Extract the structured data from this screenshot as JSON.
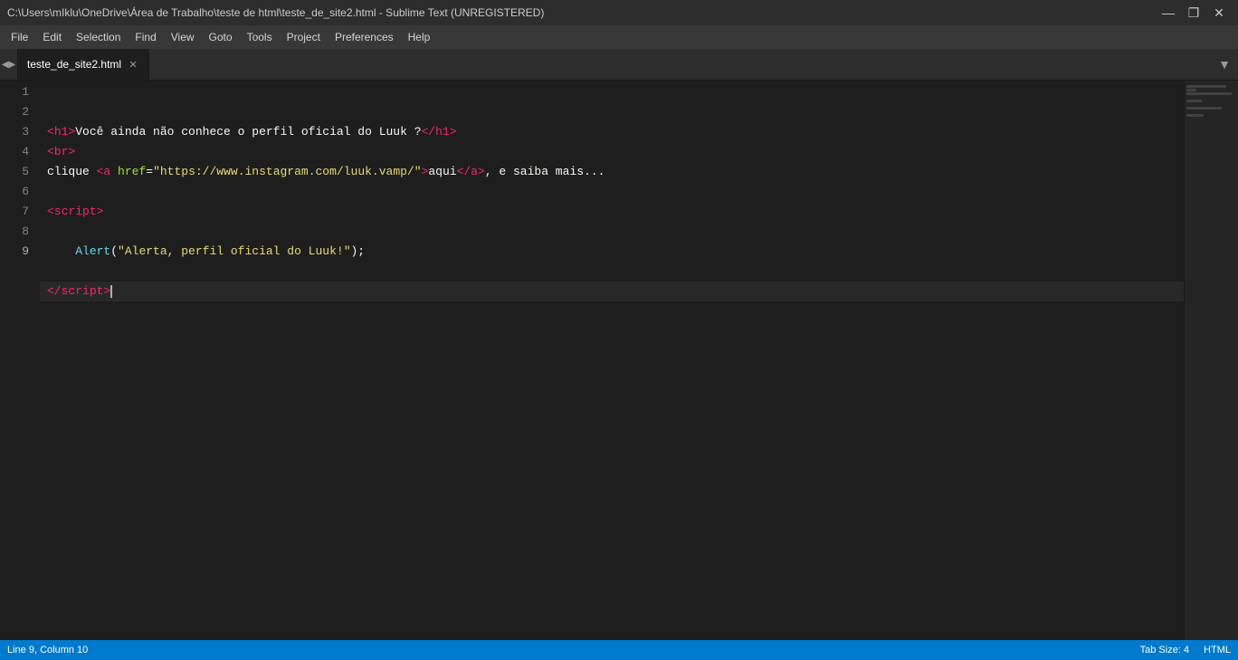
{
  "titlebar": {
    "path": "C:\\Users\\mIklu\\OneDrive\\Área de Trabalho\\teste de html\\teste_de_site2.html - Sublime Text (UNREGISTERED)",
    "minimize": "—",
    "maximize": "❐",
    "close": "✕"
  },
  "menubar": {
    "items": [
      "File",
      "Edit",
      "Selection",
      "Find",
      "View",
      "Goto",
      "Tools",
      "Project",
      "Preferences",
      "Help"
    ]
  },
  "tabs": {
    "active": "teste_de_site2.html",
    "items": [
      {
        "label": "teste_de_site2.html",
        "active": true
      }
    ]
  },
  "statusbar": {
    "left": {
      "position": "Line 9, Column 10"
    },
    "right": {
      "tab_size": "Tab Size: 4",
      "language": "HTML"
    }
  },
  "code": {
    "lines": [
      {
        "num": "1",
        "content_html": "<span class='tag'>&lt;</span><span class='tag-name'>h1</span><span class='tag'>&gt;</span><span class='plain'>Você ainda não conhece o perfil oficial do Luuk ?</span><span class='tag'>&lt;/</span><span class='tag-name'>h1</span><span class='tag'>&gt;</span>"
      },
      {
        "num": "2",
        "content_html": "<span class='tag'>&lt;</span><span class='tag-name'>br</span><span class='tag'>&gt;</span>"
      },
      {
        "num": "3",
        "content_html": "<span class='plain'>clique </span><span class='tag'>&lt;</span><span class='tag-name'>a</span><span class='plain'> </span><span class='attr-name'>href</span><span class='plain'>=</span><span class='attr-value'>\"https://www.instagram.com/luuk.vamp/\"</span><span class='tag'>&gt;</span><span class='plain'>aqui</span><span class='tag'>&lt;/</span><span class='tag-name'>a</span><span class='tag'>&gt;</span><span class='plain'>, e saiba mais...</span>"
      },
      {
        "num": "4",
        "content_html": ""
      },
      {
        "num": "5",
        "content_html": "<span class='tag'>&lt;</span><span class='keyword-script'>script</span><span class='tag'>&gt;</span>"
      },
      {
        "num": "6",
        "content_html": ""
      },
      {
        "num": "7",
        "content_html": "<span class='plain'>    </span><span class='fn-name'>Alert</span><span class='plain'>(</span><span class='string'>\"Alerta, perfil oficial do Luuk!\"</span><span class='plain'>);</span>"
      },
      {
        "num": "8",
        "content_html": ""
      },
      {
        "num": "9",
        "content_html": "<span class='tag'>&lt;/</span><span class='keyword-script'>script</span><span class='tag'>&gt;</span>",
        "active": true,
        "cursor": true
      }
    ]
  }
}
